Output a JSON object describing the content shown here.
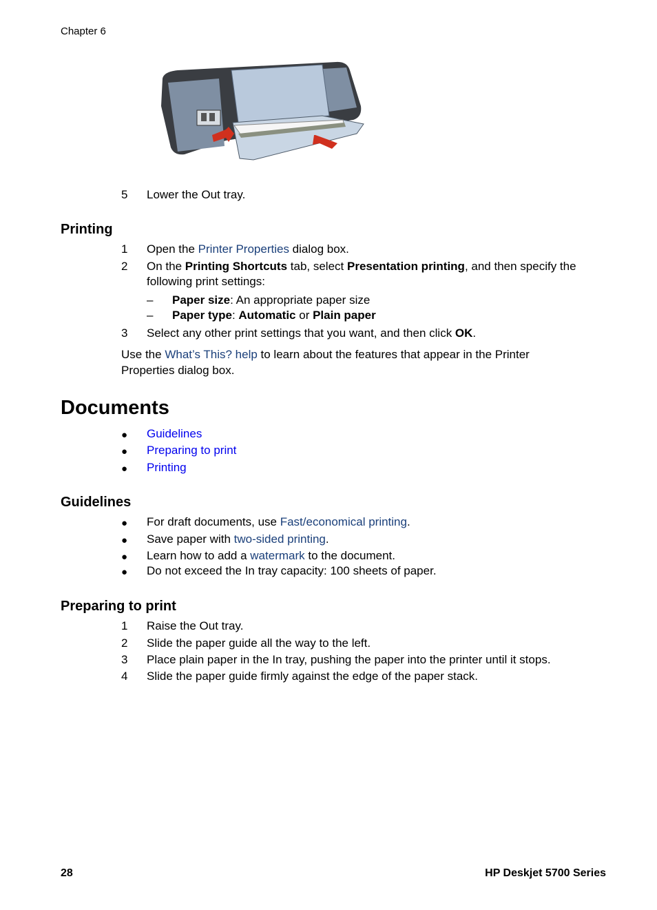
{
  "header": {
    "chapter": "Chapter 6"
  },
  "figure": {
    "alt": "printer-in-tray-illustration"
  },
  "top_step": {
    "num": "5",
    "text": "Lower the Out tray."
  },
  "printing_section": {
    "title": "Printing",
    "steps": [
      {
        "num": "1",
        "pre": "Open the ",
        "link": "Printer Properties",
        "post": " dialog box."
      },
      {
        "num": "2",
        "pre": "On the ",
        "b1": "Printing Shortcuts",
        "mid": " tab, select ",
        "b2": "Presentation printing",
        "post": ", and then specify the",
        "line2": "following print settings:"
      },
      {
        "num": "3",
        "pre": "Select any other print settings that you want, and then click ",
        "b1": "OK",
        "post": "."
      }
    ],
    "subitems": [
      {
        "dash": "–",
        "b1": "Paper size",
        "post": ": An appropriate paper size"
      },
      {
        "dash": "–",
        "b1": "Paper type",
        "mid": ": ",
        "b2": "Automatic",
        "mid2": " or ",
        "b3": "Plain paper"
      }
    ],
    "note": {
      "pre": "Use the ",
      "link": "What’s This? help",
      "post": " to learn about the features that appear in the Printer",
      "line2": "Properties dialog box."
    }
  },
  "documents_section": {
    "title": "Documents",
    "toc": [
      "Guidelines",
      "Preparing to print",
      "Printing"
    ],
    "bullet_glyph": "●"
  },
  "guidelines_section": {
    "title": "Guidelines",
    "items": [
      {
        "pre": "For draft documents, use ",
        "link": "Fast/economical printing",
        "post": "."
      },
      {
        "pre": "Save paper with ",
        "link": "two-sided printing",
        "post": "."
      },
      {
        "pre": "Learn how to add a ",
        "link": "watermark",
        "post": " to the document."
      },
      {
        "pre": "Do not exceed the In tray capacity: 100 sheets of paper.",
        "link": "",
        "post": ""
      }
    ]
  },
  "preparing_section": {
    "title": "Preparing to print",
    "steps": [
      {
        "num": "1",
        "text": "Raise the Out tray."
      },
      {
        "num": "2",
        "text": "Slide the paper guide all the way to the left."
      },
      {
        "num": "3",
        "text": "Place plain paper in the In tray, pushing the paper into the printer until it stops."
      },
      {
        "num": "4",
        "text": "Slide the paper guide firmly against the edge of the paper stack."
      }
    ]
  },
  "footer": {
    "page_number": "28",
    "product": "HP Deskjet 5700 Series"
  },
  "colors": {
    "link_bright": "#0000ee",
    "link_dark": "#1a3f7a"
  }
}
